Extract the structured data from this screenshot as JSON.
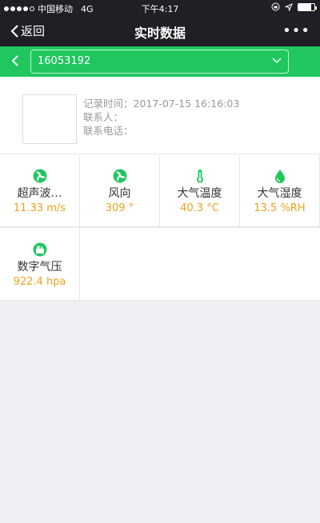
{
  "status_bar": {
    "carrier": "中国移动",
    "network": "4G",
    "time": "下午4:17"
  },
  "nav": {
    "back_label": "返回",
    "title": "实时数据",
    "more_label": "•••"
  },
  "device_select": {
    "value": "16053192"
  },
  "info": {
    "record_time_label": "记录时间：",
    "record_time": "2017-07-15 16:16:03",
    "contact_label": "联系人：",
    "phone_label": "联系电话："
  },
  "sensors": [
    {
      "name": "超声波…",
      "value": "11.33 m/s",
      "icon": "fan-icon"
    },
    {
      "name": "风向",
      "value": "309 °",
      "icon": "fan-icon"
    },
    {
      "name": "大气温度",
      "value": "40.3 °C",
      "icon": "thermometer-icon"
    },
    {
      "name": "大气湿度",
      "value": "13.5 %RH",
      "icon": "droplet-icon"
    },
    {
      "name": "数字气压",
      "value": "922.4 hpa",
      "icon": "pressure-icon"
    }
  ],
  "colors": {
    "accent_green": "#1fc75e",
    "value_orange": "#f0a21b",
    "nav_bg": "#1f1f24"
  }
}
